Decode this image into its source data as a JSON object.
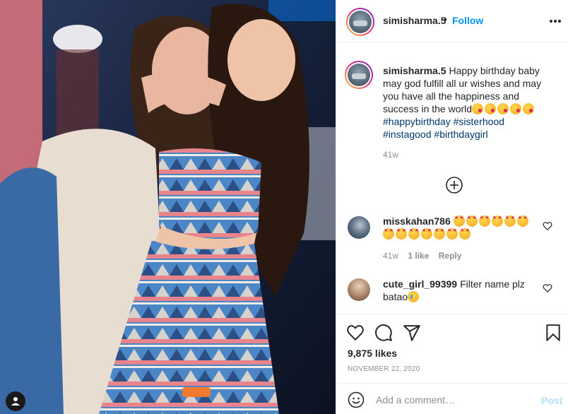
{
  "post": {
    "username": "simisharma.5",
    "follow_label": "Follow",
    "header_separator": "•"
  },
  "caption": {
    "username": "simisharma.5",
    "text": "Happy birthday baby may god fulfill all ur wishes and may you have all the happiness and success in the world",
    "emojis": [
      "kissing-heart",
      "kissing-heart",
      "kissing-heart",
      "kissing-heart",
      "kissing-heart"
    ],
    "hashtags": [
      "#happybirthday",
      "#sisterhood",
      "#instagood",
      "#birthdaygirl"
    ],
    "time": "41w"
  },
  "comments": [
    {
      "username": "misskahan786",
      "text": "",
      "emoji_count": 13,
      "emoji": "star-struck",
      "time": "41w",
      "likes": "1 like",
      "reply_label": "Reply"
    },
    {
      "username": "cute_girl_99399",
      "text": "Filter name plz batao",
      "emoji": "disappointed-relieved",
      "time": ""
    }
  ],
  "actions": {
    "likes": "9,875 likes",
    "date": "NOVEMBER 22, 2020"
  },
  "add_comment": {
    "placeholder": "Add a comment…",
    "post_label": "Post"
  },
  "icons": {
    "header_more": "more-horizontal-icon",
    "load_more": "plus-circle-icon",
    "like": "heart-icon",
    "comment": "comment-icon",
    "share": "paper-plane-icon",
    "save": "bookmark-icon",
    "emoji": "smiley-icon",
    "user_tag": "user-tag-icon"
  },
  "colors": {
    "accent": "#0095f6",
    "hashtag": "#00376b",
    "muted": "#8e8e8e",
    "post_disabled": "#b2dffc"
  }
}
